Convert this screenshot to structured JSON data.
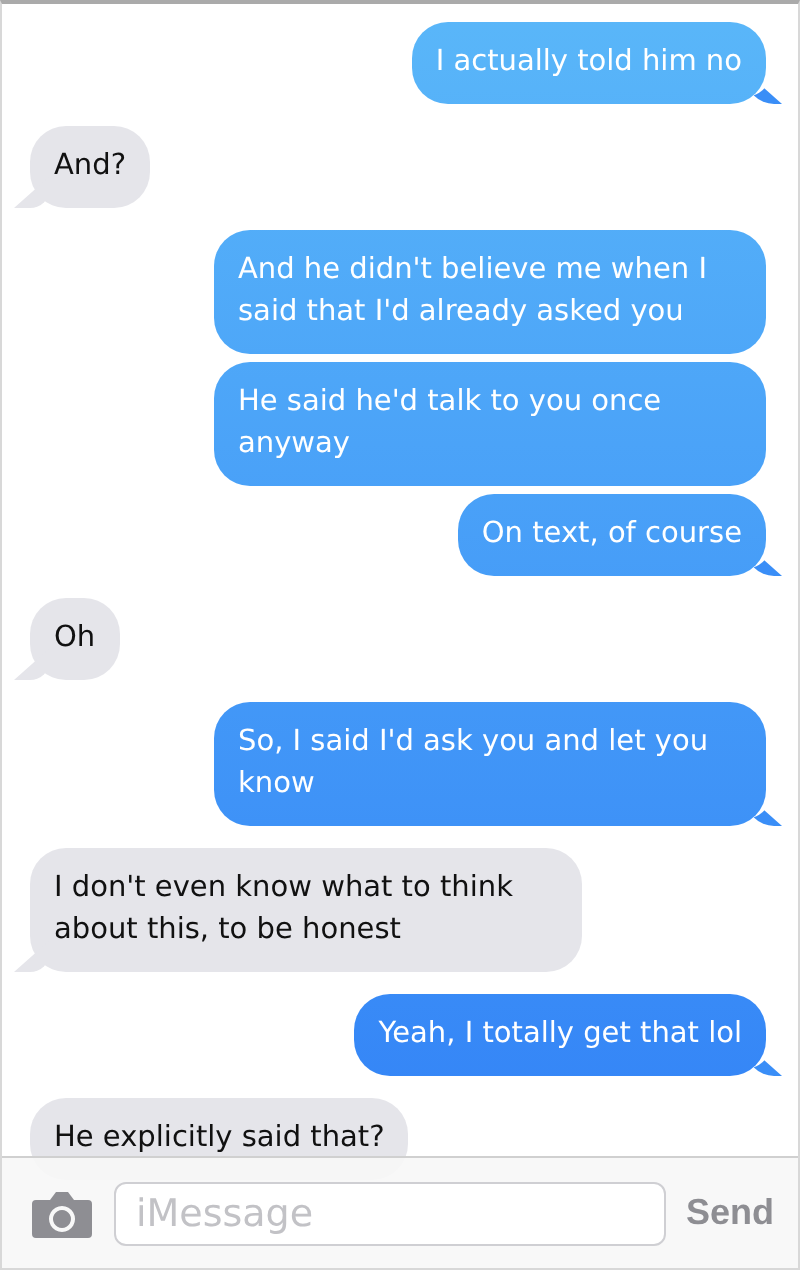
{
  "messages": [
    {
      "kind": "sent",
      "text": "I actually told him no",
      "tail": true
    },
    {
      "kind": "received",
      "text": "And?",
      "tail": true
    },
    {
      "kind": "sent",
      "text": "And he didn't believe me when I said that I'd already asked you",
      "tail": false
    },
    {
      "kind": "sent",
      "text": "He said he'd talk to you once anyway",
      "tail": false
    },
    {
      "kind": "sent",
      "text": "On text, of course",
      "tail": true
    },
    {
      "kind": "received",
      "text": "Oh",
      "tail": true
    },
    {
      "kind": "sent",
      "text": "So, I said I'd ask you and let you know",
      "tail": true
    },
    {
      "kind": "received",
      "text": "I don't even know what to think about this, to be honest",
      "tail": true
    },
    {
      "kind": "sent",
      "text": "Yeah, I totally get that lol",
      "tail": true
    },
    {
      "kind": "received",
      "text": "He explicitly said that?",
      "tail": false
    }
  ],
  "composer": {
    "placeholder": "iMessage",
    "send": "Send"
  }
}
